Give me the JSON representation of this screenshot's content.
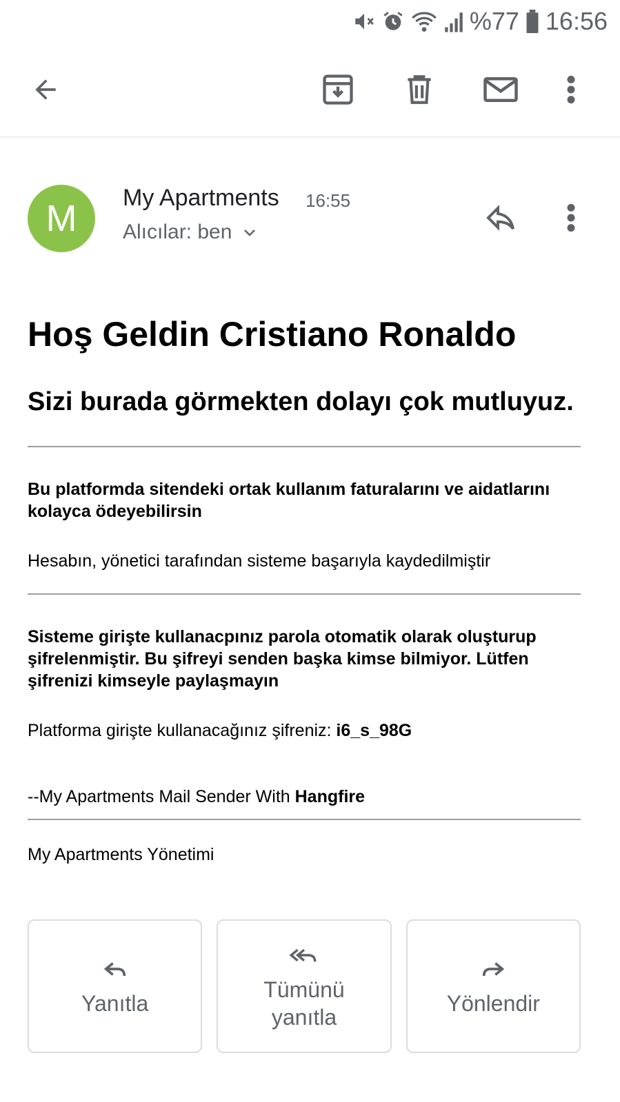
{
  "status_bar": {
    "battery": "%77",
    "time": "16:56"
  },
  "toolbar": {
    "back_icon": "arrow-back-icon",
    "archive_icon": "archive-icon",
    "delete_icon": "delete-icon",
    "mark_unread_icon": "mail-icon",
    "more_icon": "more-vert-icon"
  },
  "email": {
    "avatar_letter": "M",
    "sender": "My Apartments",
    "time": "16:55",
    "recipients": "Alıcılar: ben",
    "title": "Hoş Geldin Cristiano Ronaldo",
    "subtitle": "Sizi burada görmekten dolayı çok mutluyuz.",
    "para1_bold": "Bu platformda sitendeki ortak kullanım faturalarını ve aidatlarını kolayca ödeyebilirsin",
    "para2": "Hesabın, yönetici tarafından sisteme başarıyla kaydedilmiştir",
    "para3_bold": "Sisteme girişte kullanacpınız parola otomatik olarak oluşturup şifrelenmiştir. Bu şifreyi senden başka kimse bilmiyor. Lütfen şifrenizi kimseyle paylaşmayın",
    "password_label": "Platforma girişte kullanacağınız şifreniz: ",
    "password": "i6_s_98G",
    "signature_prefix": "--My Apartments Mail Sender With ",
    "signature_bold": "Hangfire",
    "footer": "My Apartments Yönetimi"
  },
  "actions": {
    "reply": "Yanıtla",
    "reply_all": "Tümünü yanıtla",
    "forward": "Yönlendir"
  },
  "colors": {
    "avatar": "#8bc34a",
    "icon": "#5f6368",
    "divider": "#9e9e9e"
  }
}
